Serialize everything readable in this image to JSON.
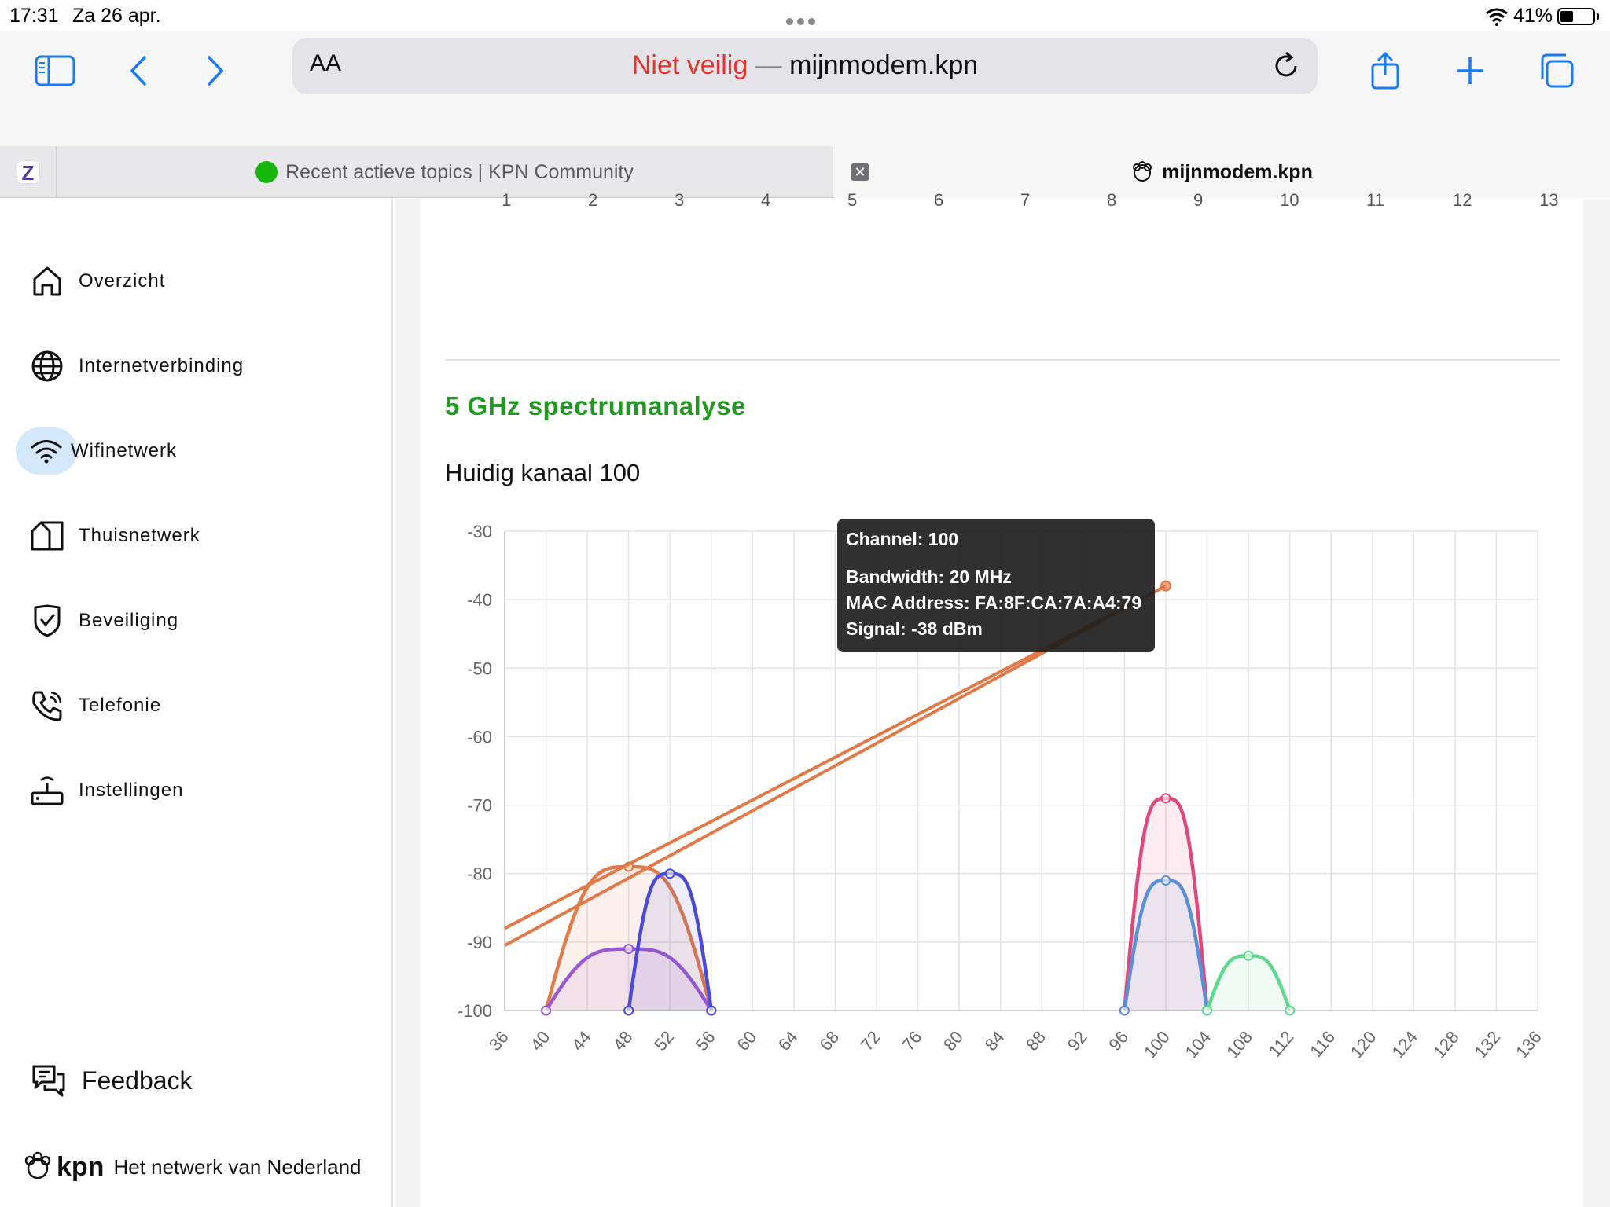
{
  "status_bar": {
    "time": "17:31",
    "date": "Za 26 apr.",
    "battery": "41%",
    "battery_level": 0.41
  },
  "toolbar": {
    "reader_label": "AA",
    "url_warning": "Niet veilig",
    "url_separator": " — ",
    "url_host": "mijnmodem.kpn"
  },
  "tabs": [
    {
      "label": "Recent actieve topics | KPN Community",
      "active": false
    },
    {
      "label": "mijnmodem.kpn",
      "active": true
    }
  ],
  "sidebar": {
    "items": [
      {
        "label": "Overzicht",
        "icon": "home-icon"
      },
      {
        "label": "Internetverbinding",
        "icon": "globe-icon"
      },
      {
        "label": "Wifinetwerk",
        "icon": "wifi-icon",
        "active": true
      },
      {
        "label": "Thuisnetwerk",
        "icon": "home-network-icon"
      },
      {
        "label": "Beveiliging",
        "icon": "shield-icon"
      },
      {
        "label": "Telefonie",
        "icon": "phone-icon"
      },
      {
        "label": "Instellingen",
        "icon": "router-icon"
      }
    ],
    "feedback_label": "Feedback",
    "brand": "kpn",
    "tagline": "Het netwerk van Nederland"
  },
  "previous_chart_axis": [
    "1",
    "2",
    "3",
    "4",
    "5",
    "6",
    "7",
    "8",
    "9",
    "10",
    "11",
    "12",
    "13"
  ],
  "section": {
    "title": "5 GHz spectrumanalyse",
    "current_channel": "Huidig kanaal 100"
  },
  "tooltip": {
    "title": "Channel: 100",
    "bandwidth": "Bandwidth: 20 MHz",
    "mac": "MAC Address: FA:8F:CA:7A:A4:79",
    "signal": "Signal: -38 dBm"
  },
  "chart_data": {
    "type": "area",
    "title": "",
    "xlabel": "",
    "ylabel": "",
    "x_ticks": [
      36,
      40,
      44,
      48,
      52,
      56,
      60,
      64,
      68,
      72,
      76,
      80,
      84,
      88,
      92,
      96,
      100,
      104,
      108,
      112,
      116,
      120,
      124,
      128,
      132,
      136
    ],
    "y_ticks": [
      -30,
      -40,
      -50,
      -60,
      -70,
      -80,
      -90,
      -100
    ],
    "xlim": [
      36,
      136
    ],
    "ylim": [
      -100,
      -30
    ],
    "grid": true,
    "legend": "none",
    "series": [
      {
        "color": "#e07a48",
        "points": [
          [
            40,
            -100
          ],
          [
            48,
            -79
          ],
          [
            56,
            -100
          ]
        ]
      },
      {
        "color": "#9b59d0",
        "points": [
          [
            40,
            -100
          ],
          [
            48,
            -91
          ],
          [
            56,
            -100
          ]
        ]
      },
      {
        "color": "#4a4ad8",
        "points": [
          [
            48,
            -100
          ],
          [
            52,
            -80
          ],
          [
            56,
            -100
          ]
        ]
      },
      {
        "color": "#e0487a",
        "points": [
          [
            96,
            -100
          ],
          [
            100,
            -69
          ],
          [
            104,
            -100
          ]
        ]
      },
      {
        "color": "#5b8fd6",
        "points": [
          [
            96,
            -100
          ],
          [
            100,
            -81
          ],
          [
            104,
            -100
          ]
        ]
      },
      {
        "color": "#5fd98f",
        "points": [
          [
            104,
            -100
          ],
          [
            108,
            -92
          ],
          [
            112,
            -100
          ]
        ]
      },
      {
        "color": "#e07a48",
        "points": [
          [
            36,
            -88
          ],
          [
            100,
            -38
          ]
        ],
        "kind": "line"
      },
      {
        "color": "#e07a48",
        "points": [
          [
            36,
            -90.5
          ],
          [
            100,
            -38
          ]
        ],
        "kind": "line"
      }
    ]
  }
}
